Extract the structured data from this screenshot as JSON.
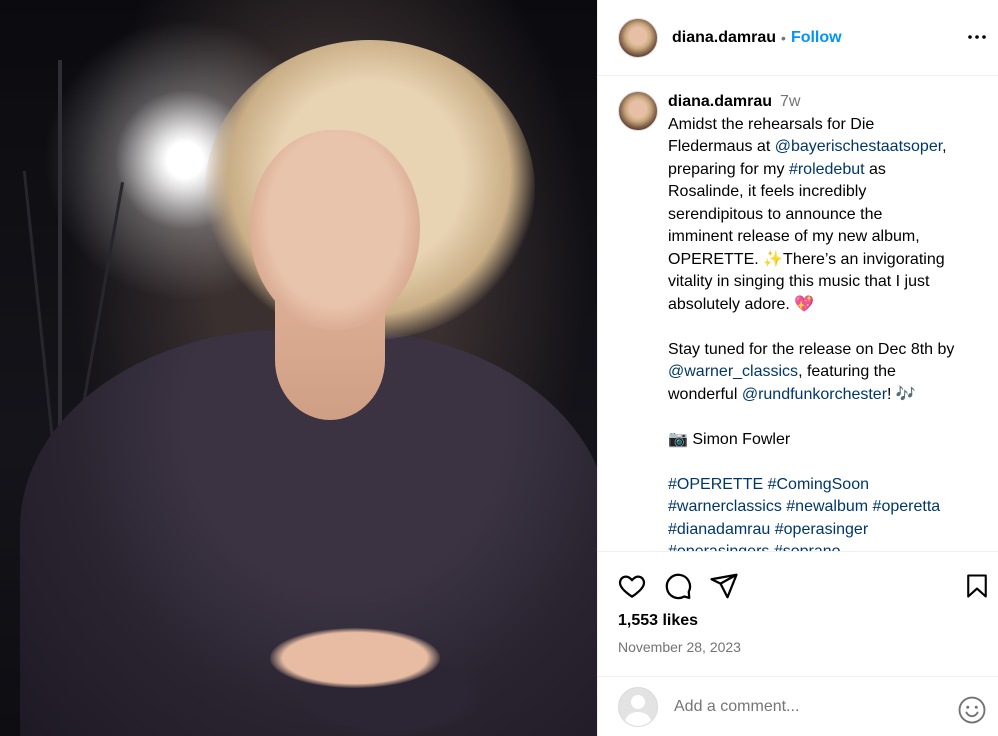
{
  "post": {
    "username": "diana.damrau",
    "follow_label": "Follow",
    "separator": "•",
    "more_icon": "more-horizontal-icon"
  },
  "caption": {
    "username": "diana.damrau",
    "time": "7w",
    "lines": [
      "Amidst the rehearsals for Die",
      "Fledermaus at ",
      "@bayerischestaatsoper",
      ",",
      "preparing for my ",
      "#roledebut",
      " as",
      "Rosalinde, it feels incredibly",
      "serendipitous to announce the",
      "imminent release of my new album,",
      "OPERETTE. ✨There’s an invigorating",
      "vitality in singing this music that I just",
      "absolutely adore. 💖",
      "Stay tuned for the release on Dec 8th by",
      "@warner_classics",
      ", featuring the",
      "wonderful ",
      "@rundfunkorchester",
      "! 🎶",
      "📷 Simon Fowler",
      "#OPERETTE",
      " ",
      "#ComingSoon",
      "#warnerclassics",
      "#newalbum",
      "#operetta",
      "#dianadamrau",
      "#operasinger",
      "#operasingers",
      "#soprano"
    ]
  },
  "actions": {
    "like_icon": "heart-icon",
    "comment_icon": "comment-icon",
    "share_icon": "share-icon",
    "save_icon": "bookmark-icon"
  },
  "likes": "1,553 likes",
  "date": "November 28, 2023",
  "comment_box": {
    "placeholder": "Add a comment...",
    "emoji_icon": "smiley-icon"
  }
}
